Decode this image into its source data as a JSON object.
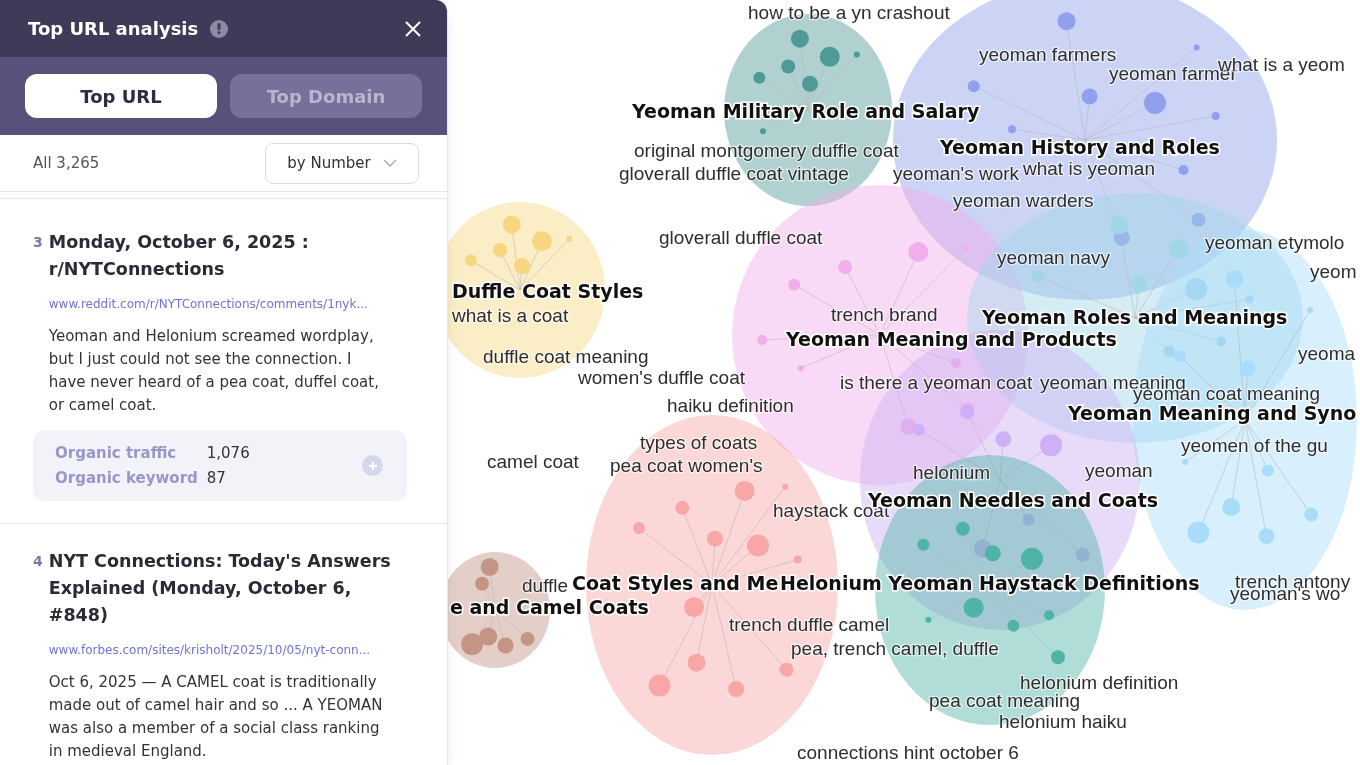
{
  "panel": {
    "title": "Top URL analysis",
    "tabs": [
      {
        "label": "Top URL",
        "selected": true
      },
      {
        "label": "Top Domain",
        "selected": false
      }
    ],
    "count": "All 3,265",
    "sort": "by Number",
    "results": [
      {
        "rank": "3",
        "title": "Monday, October 6, 2025 : r/NYTConnections",
        "url": "www.reddit.com/r/NYTConnections/comments/1nyk...",
        "snippet": "Yeoman and Helonium screamed wordplay, but I just could not see the connection. I have never heard of a pea coat, duffel coat, or camel coat.",
        "metrics": [
          {
            "label": "Organic traffic",
            "value": "1,076"
          },
          {
            "label": "Organic keyword",
            "value": "87"
          }
        ]
      },
      {
        "rank": "4",
        "title": "NYT Connections: Today's Answers Explained (Monday, October 6, #848)",
        "url": "www.forbes.com/sites/krisholt/2025/10/05/nyt-conn...",
        "snippet": "Oct 6, 2025 — A CAMEL coat is traditionally made out of camel hair and so ... A YEOMAN was also a member of a social class ranking in medieval England."
      }
    ]
  },
  "graph": {
    "clusters": [
      {
        "label": "Yeoman Military Role and Salary",
        "color": "#4f9a96"
      },
      {
        "label": "Yeoman History and Roles",
        "color": "#8fa0ec"
      },
      {
        "label": "Duffle Coat Styles",
        "color": "#f6d67e"
      },
      {
        "label": "Yeoman Meaning and Products",
        "color": "#f2aeea"
      },
      {
        "label": "Yeoman Roles and Meanings",
        "color": "#9fd6e8"
      },
      {
        "label": "Yeoman Meaning and Syno",
        "color": "#a9dcfb"
      },
      {
        "label": "Yeoman Needles and Coats",
        "color": "#cdb0f5"
      },
      {
        "label": "Coat Styles and Me",
        "color": "#f9a6a6"
      },
      {
        "label": "Helonium Yeoman Haystack Definitions",
        "color": "#4fb3a6"
      },
      {
        "label": "e and Camel Coats",
        "color": "#c49584"
      }
    ],
    "keywords": [
      "how to be a yn crashout",
      "yeoman farmers",
      "yeoman farmer",
      "what is a yeom",
      "original montgomery duffle coat",
      "gloverall duffle coat vintage",
      "yeoman's work",
      "what is yeoman",
      "yeoman warders",
      "gloverall duffle coat",
      "yeoman etymolo",
      "yeoman navy",
      "yeom",
      "what is a coat",
      "trench brand",
      "duffle coat meaning",
      "yeoma",
      "women's duffle coat",
      "is there a yeoman coat",
      "yeoman meaning",
      "yeoman coat meaning",
      "haiku definition",
      "yeomen of the gu",
      "camel coat",
      "types of coats",
      "pea coat women's",
      "helonium",
      "yeoman",
      "haystack coat",
      "duffle",
      "trench antony",
      "yeoman's wo",
      "trench duffle camel",
      "pea, trench camel, duffle",
      "helonium definition",
      "pea coat meaning",
      "helonium haiku",
      "connections hint october 6"
    ]
  }
}
